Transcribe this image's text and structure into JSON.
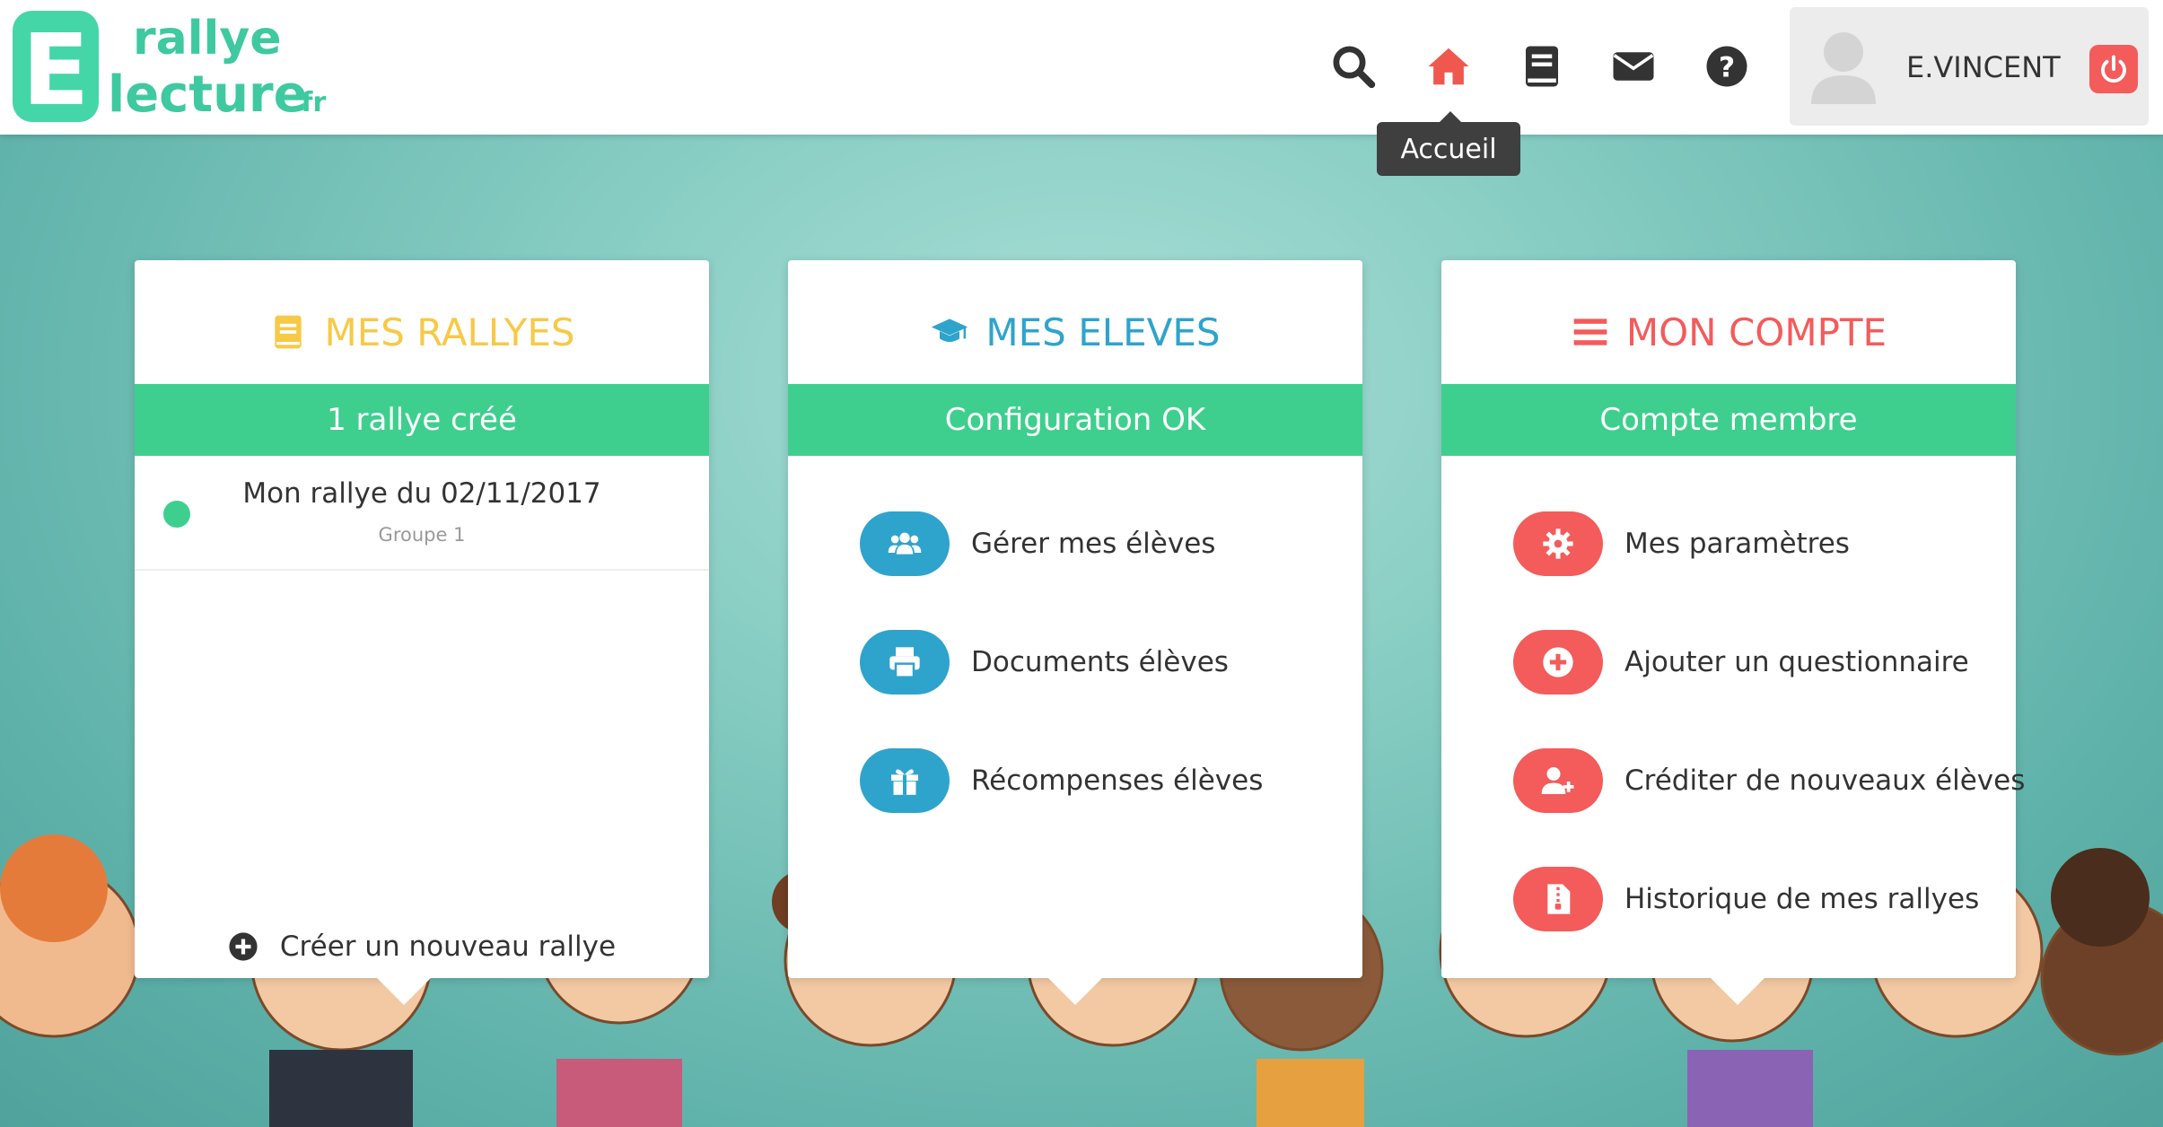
{
  "header": {
    "logo": {
      "line1": "rallye",
      "line2": "lecture",
      "suffix": ".fr",
      "letter": "E"
    },
    "nav": [
      {
        "name": "search",
        "icon": "search-icon"
      },
      {
        "name": "home",
        "icon": "home-icon",
        "active": true
      },
      {
        "name": "book",
        "icon": "book-icon"
      },
      {
        "name": "mail",
        "icon": "envelope-icon"
      },
      {
        "name": "help",
        "icon": "question-circle-icon"
      }
    ],
    "tooltip": "Accueil",
    "user": {
      "name": "E.VINCENT",
      "icon": "user-avatar-icon",
      "logout_icon": "power-icon"
    }
  },
  "colors": {
    "yellow": "#f7c948",
    "blue": "#2ea4cc",
    "red": "#f45b5b",
    "green": "#3ecf8e",
    "home_active": "#f0584f"
  },
  "cards": {
    "rallyes": {
      "title": "MES RALLYES",
      "icon": "book-icon",
      "status": "1 rallye créé",
      "items": [
        {
          "name": "Mon rallye du 02/11/2017",
          "group": "Groupe 1"
        }
      ],
      "create_label": "Créer un nouveau rallye",
      "create_icon": "plus-circle-icon"
    },
    "eleves": {
      "title": "MES ELEVES",
      "icon": "graduation-cap-icon",
      "status": "Configuration OK",
      "items": [
        {
          "label": "Gérer mes élèves",
          "icon": "users-icon"
        },
        {
          "label": "Documents élèves",
          "icon": "print-icon"
        },
        {
          "label": "Récompenses élèves",
          "icon": "gift-icon"
        }
      ]
    },
    "compte": {
      "title": "MON COMPTE",
      "icon": "menu-bars-icon",
      "status": "Compte membre",
      "items": [
        {
          "label": "Mes paramètres",
          "icon": "gear-icon"
        },
        {
          "label": "Ajouter un questionnaire",
          "icon": "plus-circle-icon"
        },
        {
          "label": "Créditer de nouveaux élèves",
          "icon": "user-plus-icon"
        },
        {
          "label": "Historique de mes rallyes",
          "icon": "archive-file-icon"
        }
      ]
    }
  }
}
